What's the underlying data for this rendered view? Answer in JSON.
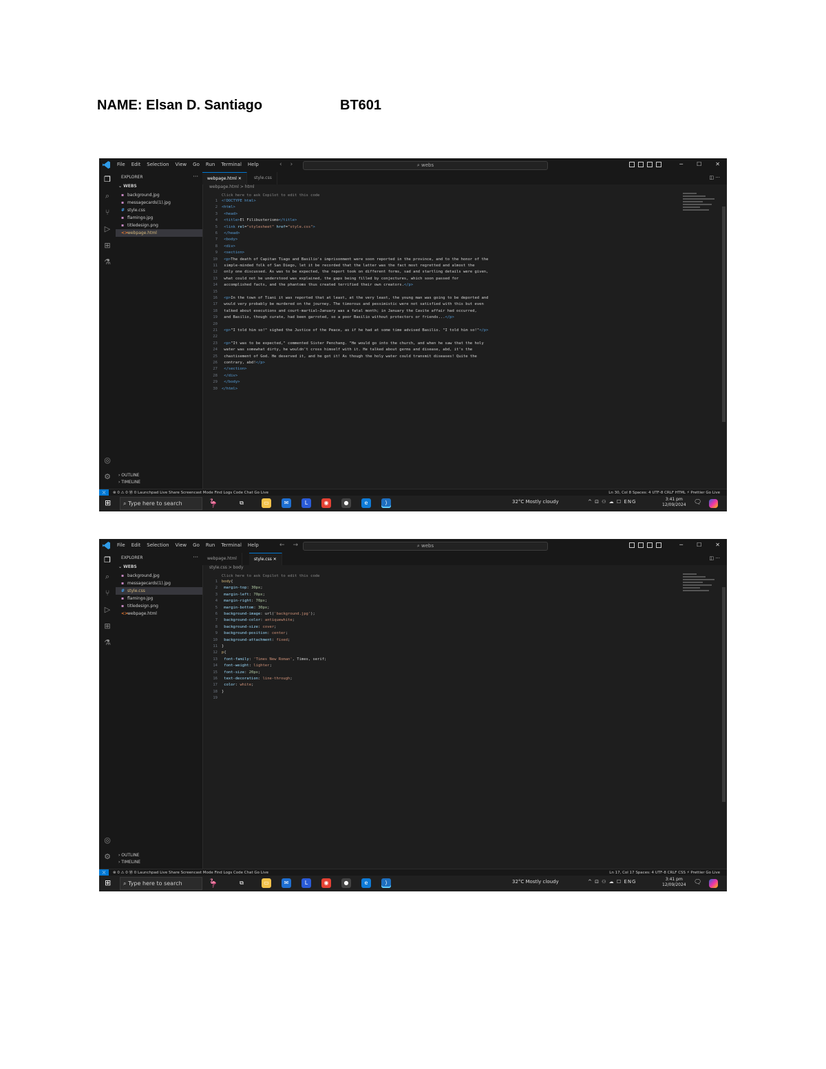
{
  "header": {
    "name": "NAME: Elsan D. Santiago",
    "code": "BT601"
  },
  "screens": [
    {
      "menu": [
        "File",
        "Edit",
        "Selection",
        "View",
        "Go",
        "Run",
        "Terminal",
        "Help"
      ],
      "nav": [
        "‹",
        "›"
      ],
      "command_center": "webs",
      "sidebar": {
        "title": "EXPLORER",
        "folder": "WEBS",
        "files": [
          {
            "icon": "img",
            "name": "background.jpg",
            "selected": false
          },
          {
            "icon": "img",
            "name": "messagecards(1).jpg",
            "selected": false
          },
          {
            "icon": "css",
            "name": "style.css",
            "selected": false
          },
          {
            "icon": "img",
            "name": "flamingo.jpg",
            "selected": false
          },
          {
            "icon": "img",
            "name": "titledesign.png",
            "selected": false
          },
          {
            "icon": "html",
            "name": "webpage.html",
            "selected": true
          }
        ],
        "outline": "OUTLINE",
        "timeline": "TIMELINE"
      },
      "tabs": [
        {
          "label": "webpage.html",
          "active": true
        },
        {
          "label": "style.css",
          "active": false
        }
      ],
      "breadcrumb": "webpage.html > html",
      "hint": "Click here to ask Copilot to edit this code",
      "code": [
        {
          "n": "1",
          "parts": [
            [
              "tag",
              "<!DOCTYPE html>"
            ]
          ]
        },
        {
          "n": "2",
          "parts": [
            [
              "tag",
              "<html>"
            ]
          ]
        },
        {
          "n": "3",
          "parts": [
            [
              "tag",
              "    <head>"
            ]
          ]
        },
        {
          "n": "4",
          "parts": [
            [
              "tag",
              "        <title>"
            ],
            [
              "txt",
              "El Filibusterismo"
            ],
            [
              "tag",
              "</title>"
            ]
          ]
        },
        {
          "n": "5",
          "parts": [
            [
              "tag",
              "        <link "
            ],
            [
              "attr",
              "rel"
            ],
            [
              "txt",
              "="
            ],
            [
              "val",
              "\"stylesheet\" "
            ],
            [
              "attr",
              "href"
            ],
            [
              "txt",
              "="
            ],
            [
              "val",
              "\"style.css\""
            ],
            [
              "tag",
              ">"
            ]
          ]
        },
        {
          "n": "6",
          "parts": [
            [
              "tag",
              "    </head>"
            ]
          ]
        },
        {
          "n": "7",
          "parts": [
            [
              "tag",
              "    <body>"
            ]
          ]
        },
        {
          "n": "8",
          "parts": [
            [
              "tag",
              "        <div>"
            ]
          ]
        },
        {
          "n": "9",
          "parts": [
            [
              "tag",
              "            <section>"
            ]
          ]
        },
        {
          "n": "10",
          "parts": [
            [
              "tag",
              "                <p>"
            ],
            [
              "txt",
              "The death of Capitan Tiago and Basilio's imprisonment were soon reported in the province, and to the honor of the"
            ]
          ]
        },
        {
          "n": "11",
          "parts": [
            [
              "txt",
              "                    simple-minded folk of San Diego, let it be recorded that the latter was the fact most regretted and almost the"
            ]
          ]
        },
        {
          "n": "12",
          "parts": [
            [
              "txt",
              "                    only one discussed. As was to be expected, the report took on different forms, sad and startling details were given,"
            ]
          ]
        },
        {
          "n": "13",
          "parts": [
            [
              "txt",
              "                    what could not be understood was explained, the gaps being filled by conjectures, which soon passed for"
            ]
          ]
        },
        {
          "n": "14",
          "parts": [
            [
              "txt",
              "                    accomplished facts, and the phantoms thus created terrified their own creators."
            ],
            [
              "tag",
              "</p>"
            ]
          ]
        },
        {
          "n": "15",
          "parts": []
        },
        {
          "n": "16",
          "parts": [
            [
              "tag",
              "                <p>"
            ],
            [
              "txt",
              "In the town of Tiani it was reported that at least, at the very least, the young man was going to be deported and"
            ]
          ]
        },
        {
          "n": "17",
          "parts": [
            [
              "txt",
              "                    would very probably be murdered on the journey. The timorous and pessimistic were not satisfied with this but even"
            ]
          ]
        },
        {
          "n": "18",
          "parts": [
            [
              "txt",
              "                    talked about executions and court-martial—January was a fatal month; in January the Cavite affair had occurred,"
            ]
          ]
        },
        {
          "n": "19",
          "parts": [
            [
              "txt",
              "                    and Basilio, though curate, had been garroted, so a poor Basilio without protectors or friends..."
            ],
            [
              "tag",
              "</p>"
            ]
          ]
        },
        {
          "n": "20",
          "parts": []
        },
        {
          "n": "21",
          "parts": [
            [
              "tag",
              "                <p>"
            ],
            [
              "txt",
              "\"I told him so!\" sighed the Justice of the Peace, as if he had at some time advised Basilio. \"I told him so!\""
            ],
            [
              "tag",
              "</p>"
            ]
          ]
        },
        {
          "n": "22",
          "parts": []
        },
        {
          "n": "23",
          "parts": [
            [
              "tag",
              "                <p>"
            ],
            [
              "txt",
              "\"It was to be expected,\" commented Sister Penchang. \"He would go into the church, and when he saw that the holy"
            ]
          ]
        },
        {
          "n": "24",
          "parts": [
            [
              "txt",
              "                    water was somewhat dirty, he wouldn't cross himself with it. He talked about germs and disease, abd, it's the"
            ]
          ]
        },
        {
          "n": "25",
          "parts": [
            [
              "txt",
              "                    chastisement of God. He deserved it, and he got it! As though the holy water could transmit diseases! Quite the"
            ]
          ]
        },
        {
          "n": "26",
          "parts": [
            [
              "txt",
              "                    contrary, abd!"
            ],
            [
              "tag",
              "</p>"
            ]
          ]
        },
        {
          "n": "27",
          "parts": [
            [
              "tag",
              "            </section>"
            ]
          ]
        },
        {
          "n": "28",
          "parts": [
            [
              "tag",
              "        </div>"
            ]
          ]
        },
        {
          "n": "29",
          "parts": [
            [
              "tag",
              "    </body>"
            ]
          ]
        },
        {
          "n": "30",
          "parts": [
            [
              "tag",
              "</html>"
            ]
          ]
        }
      ],
      "status_left": [
        "⊗ 0 ⚠ 0",
        "Ⓦ 0",
        "Launchpad",
        "Live Share",
        "Screencast Mode",
        "Find Logs",
        "Code Chat",
        "Go Live"
      ],
      "status_right": [
        "Ln 30, Col 8",
        "Spaces: 4",
        "UTF-8",
        "CRLF",
        "HTML",
        "⚡ Prettier",
        "Go Live"
      ],
      "taskbar": {
        "search_placeholder": "Type here to search",
        "weather": "32°C  Mostly cloudy",
        "tray": "^  ⊡  ⚇  ☁  ☐  ENG",
        "time": "3:41 pm",
        "date": "12/09/2024"
      }
    },
    {
      "menu": [
        "File",
        "Edit",
        "Selection",
        "View",
        "Go",
        "Run",
        "Terminal",
        "Help"
      ],
      "nav": [
        "←",
        "→"
      ],
      "command_center": "webs",
      "sidebar": {
        "title": "EXPLORER",
        "folder": "WEBS",
        "files": [
          {
            "icon": "img",
            "name": "background.jpg",
            "selected": false
          },
          {
            "icon": "img",
            "name": "messagecards(1).jpg",
            "selected": false
          },
          {
            "icon": "css",
            "name": "style.css",
            "selected": true
          },
          {
            "icon": "img",
            "name": "flamingo.jpg",
            "selected": false
          },
          {
            "icon": "img",
            "name": "titledesign.png",
            "selected": false
          },
          {
            "icon": "html",
            "name": "webpage.html",
            "selected": false
          }
        ],
        "outline": "OUTLINE",
        "timeline": "TIMELINE"
      },
      "tabs": [
        {
          "label": "webpage.html",
          "active": false
        },
        {
          "label": "style.css",
          "active": true
        }
      ],
      "breadcrumb": "style.css > body",
      "hint": "Click here to ask Copilot to edit this code",
      "code": [
        {
          "n": "1",
          "parts": [
            [
              "sel",
              "body"
            ],
            [
              "txt",
              "{"
            ]
          ]
        },
        {
          "n": "2",
          "parts": [
            [
              "prop",
              "    margin-top"
            ],
            [
              "txt",
              ": "
            ],
            [
              "num",
              "30px"
            ],
            [
              "txt",
              ";"
            ]
          ]
        },
        {
          "n": "3",
          "parts": [
            [
              "prop",
              "    margin-left"
            ],
            [
              "txt",
              ": "
            ],
            [
              "num",
              "70px"
            ],
            [
              "txt",
              ";"
            ]
          ]
        },
        {
          "n": "4",
          "parts": [
            [
              "prop",
              "    margin-right"
            ],
            [
              "txt",
              ": "
            ],
            [
              "num",
              "70px"
            ],
            [
              "txt",
              ";"
            ]
          ]
        },
        {
          "n": "5",
          "parts": [
            [
              "prop",
              "    margin-bottom"
            ],
            [
              "txt",
              ": "
            ],
            [
              "num",
              "30px"
            ],
            [
              "txt",
              ";"
            ]
          ]
        },
        {
          "n": "6",
          "parts": [
            [
              "prop",
              "    background-image"
            ],
            [
              "txt",
              ": url("
            ],
            [
              "val",
              "'background.jpg'"
            ],
            [
              "txt",
              ");"
            ]
          ]
        },
        {
          "n": "7",
          "parts": [
            [
              "prop",
              "    background-color"
            ],
            [
              "txt",
              ": "
            ],
            [
              "val",
              "antiquewhite"
            ],
            [
              "txt",
              ";"
            ]
          ]
        },
        {
          "n": "8",
          "parts": [
            [
              "prop",
              "    background-size"
            ],
            [
              "txt",
              ": "
            ],
            [
              "val",
              "cover"
            ],
            [
              "txt",
              ";"
            ]
          ]
        },
        {
          "n": "9",
          "parts": [
            [
              "prop",
              "    background-position"
            ],
            [
              "txt",
              ": "
            ],
            [
              "val",
              "center"
            ],
            [
              "txt",
              ";"
            ]
          ]
        },
        {
          "n": "10",
          "parts": [
            [
              "prop",
              "    background-attachment"
            ],
            [
              "txt",
              ": "
            ],
            [
              "val",
              "fixed"
            ],
            [
              "txt",
              ";"
            ]
          ]
        },
        {
          "n": "11",
          "parts": [
            [
              "txt",
              "}"
            ]
          ]
        },
        {
          "n": "12",
          "parts": [
            [
              "sel",
              "p"
            ],
            [
              "txt",
              "{"
            ]
          ]
        },
        {
          "n": "13",
          "parts": [
            [
              "prop",
              "    font-family"
            ],
            [
              "txt",
              ": "
            ],
            [
              "val",
              "'Times New Roman'"
            ],
            [
              "txt",
              ", Times, serif;"
            ]
          ]
        },
        {
          "n": "14",
          "parts": [
            [
              "prop",
              "    font-weight"
            ],
            [
              "txt",
              ": "
            ],
            [
              "val",
              "lighter"
            ],
            [
              "txt",
              ";"
            ]
          ]
        },
        {
          "n": "15",
          "parts": [
            [
              "prop",
              "    font-size"
            ],
            [
              "txt",
              ": "
            ],
            [
              "num",
              "20px"
            ],
            [
              "txt",
              ";"
            ]
          ]
        },
        {
          "n": "16",
          "parts": [
            [
              "prop",
              "    text-decoration"
            ],
            [
              "txt",
              ": "
            ],
            [
              "val",
              "line-through"
            ],
            [
              "txt",
              ";"
            ]
          ]
        },
        {
          "n": "17",
          "parts": [
            [
              "prop",
              "    color"
            ],
            [
              "txt",
              ": "
            ],
            [
              "val",
              "white"
            ],
            [
              "txt",
              ";"
            ]
          ]
        },
        {
          "n": "18",
          "parts": [
            [
              "txt",
              "}"
            ]
          ]
        },
        {
          "n": "19",
          "parts": []
        }
      ],
      "status_left": [
        "⊗ 0 ⚠ 0",
        "Ⓦ 0",
        "Launchpad",
        "Live Share",
        "Screencast Mode",
        "Find Logs",
        "Code Chat",
        "Go Live"
      ],
      "status_right": [
        "Ln 17, Col 17",
        "Spaces: 4",
        "UTF-8",
        "CRLF",
        "CSS",
        "⚡ Prettier",
        "Go Live"
      ],
      "taskbar": {
        "search_placeholder": "Type here to search",
        "weather": "32°C  Mostly cloudy",
        "tray": "^  ⊡  ⚇  ☁  ☐  ENG",
        "time": "3:41 pm",
        "date": "12/09/2024"
      }
    }
  ],
  "icons": {
    "activity": [
      "explorer-icon",
      "search-icon",
      "source-control-icon",
      "run-debug-icon",
      "extensions-icon",
      "testing-icon"
    ],
    "taskbar_apps": [
      "file-explorer-icon",
      "mail-icon",
      "launcher-icon",
      "chrome-icon",
      "obs-icon",
      "edge-icon",
      "vscode-icon"
    ]
  },
  "colors": {
    "editor_bg": "#1e1e1e",
    "sidebar_bg": "#181818",
    "accent": "#0078d4",
    "taskbar_bg": "#202020"
  }
}
